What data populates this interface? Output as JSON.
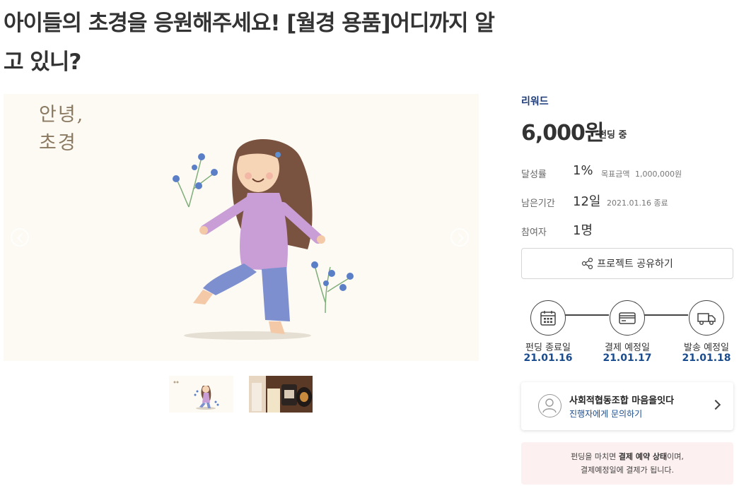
{
  "project": {
    "title": "아이들의 초경을 응원해주세요! [월경 용품]어디까지 알고 있니?",
    "hero_caption_line1": "안녕,",
    "hero_caption_line2": "초경"
  },
  "sidebar": {
    "reward_label": "리워드",
    "price": "6,000원",
    "price_status": "펀딩 중",
    "stats": [
      {
        "label": "달성률",
        "value": "1%",
        "sub_label": "목표금액",
        "sub_value": "1,000,000원"
      },
      {
        "label": "남은기간",
        "value": "12일",
        "sub_value": "2021.01.16 종료"
      },
      {
        "label": "참여자",
        "value": "1명"
      }
    ],
    "share_button_label": "프로젝트 공유하기",
    "timeline": [
      {
        "label": "펀딩 종료일",
        "date": "21.01.16",
        "icon": "calendar-icon"
      },
      {
        "label": "결제 예정일",
        "date": "21.01.17",
        "icon": "credit-card-icon"
      },
      {
        "label": "발송 예정일",
        "date": "21.01.18",
        "icon": "delivery-truck-icon"
      }
    ],
    "creator": {
      "name": "사회적협동조합 마음을잇다",
      "contact_label": "진행자에게 문의하기"
    },
    "notice": {
      "line1_prefix": "펀딩을 마치면 ",
      "line1_bold": "결제 예약 상태",
      "line1_suffix": "이며,",
      "line2": "결제예정일에 결제가 됩니다."
    }
  },
  "colors": {
    "accent_blue": "#1a4b8c",
    "notice_bg": "#fdf0f0",
    "hero_bg": "#fdfaf3"
  }
}
